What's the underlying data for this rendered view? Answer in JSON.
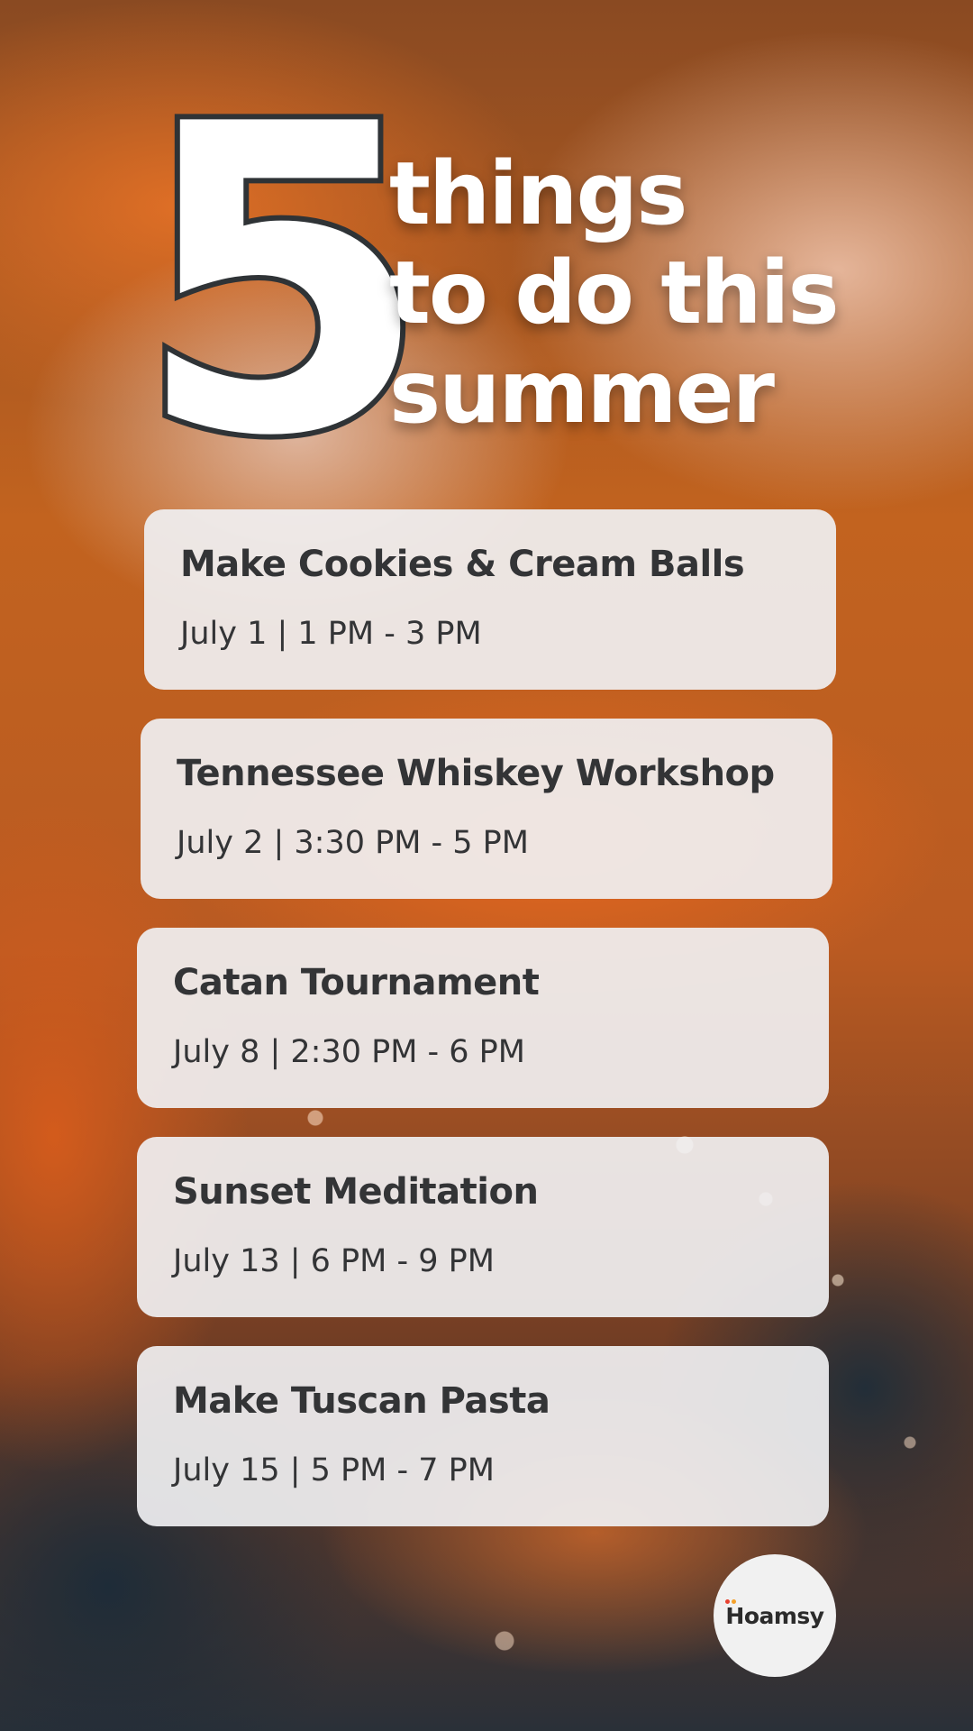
{
  "hero": {
    "number": "5",
    "headline_lines": [
      "things",
      "to do this",
      "summer"
    ]
  },
  "events": [
    {
      "title": "Make Cookies & Cream Balls",
      "when": "July 1 | 1 PM - 3 PM"
    },
    {
      "title": "Tennessee Whiskey Workshop",
      "when": "July 2 | 3:30 PM - 5 PM"
    },
    {
      "title": "Catan Tournament",
      "when": "July 8 | 2:30 PM - 6 PM"
    },
    {
      "title": "Sunset Meditation",
      "when": "July 13 | 6 PM - 9 PM"
    },
    {
      "title": "Make Tuscan Pasta",
      "when": "July 15 | 5 PM - 7 PM"
    }
  ],
  "brand": {
    "logo_text": "Hoamsy",
    "colors": {
      "dot_primary": "#e8412f",
      "dot_secondary": "#f4a12a"
    }
  },
  "colors": {
    "card_bg": "#f0f0f2",
    "text_dark": "#333436",
    "accent_orange": "#c2631f"
  }
}
